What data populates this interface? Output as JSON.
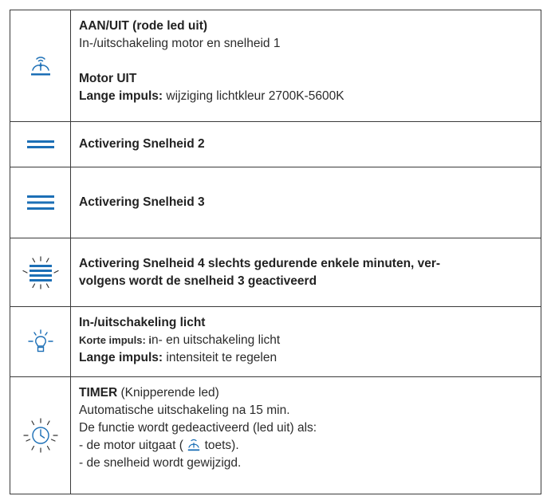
{
  "rows": [
    {
      "icon": "fan-power-icon",
      "lines": [
        {
          "bold": "AAN/UIT (rode led uit)"
        },
        {
          "text": "In-/uitschakeling motor en snelheid 1"
        },
        {
          "bold": "Motor UIT"
        },
        {
          "bold": "Lange impuls:",
          "text": " wijziging lichtkleur 2700K-5600K"
        }
      ]
    },
    {
      "icon": "speed-2-icon",
      "lines": [
        {
          "bold": "Activering Snelheid 2"
        }
      ]
    },
    {
      "icon": "speed-3-icon",
      "lines": [
        {
          "bold": "Activering Snelheid 3"
        }
      ]
    },
    {
      "icon": "speed-4-icon",
      "lines": [
        {
          "bold": "Activering Snelheid 4 slechts gedurende enkele minuten, ver-"
        },
        {
          "bold": "volgens wordt de snelheid 3 geactiveerd"
        }
      ]
    },
    {
      "icon": "light-bulb-icon",
      "lines": [
        {
          "bold": "In-/uitschakeling licht"
        },
        {
          "bold": "Korte impuls: i",
          "text": "n- en uitschakeling licht"
        },
        {
          "bold": "Lange impuls:",
          "text": " intensiteit te regelen"
        }
      ]
    },
    {
      "icon": "timer-clock-icon",
      "lines": [
        {
          "bold": "TIMER",
          "text": " (Knipperende led)"
        },
        {
          "text": "Automatische uitschakeling na 15 min."
        },
        {
          "text": "De functie wordt gedeactiveerd (led uit) als:"
        },
        {
          "text": "- de motor uitgaat (",
          "text_after": " toets)."
        },
        {
          "text": "- de snelheid wordt gewijzigd."
        }
      ]
    }
  ],
  "colors": {
    "icon": "#1c6fb6",
    "border": "#3a3a3a",
    "text": "#2b2b2b"
  }
}
